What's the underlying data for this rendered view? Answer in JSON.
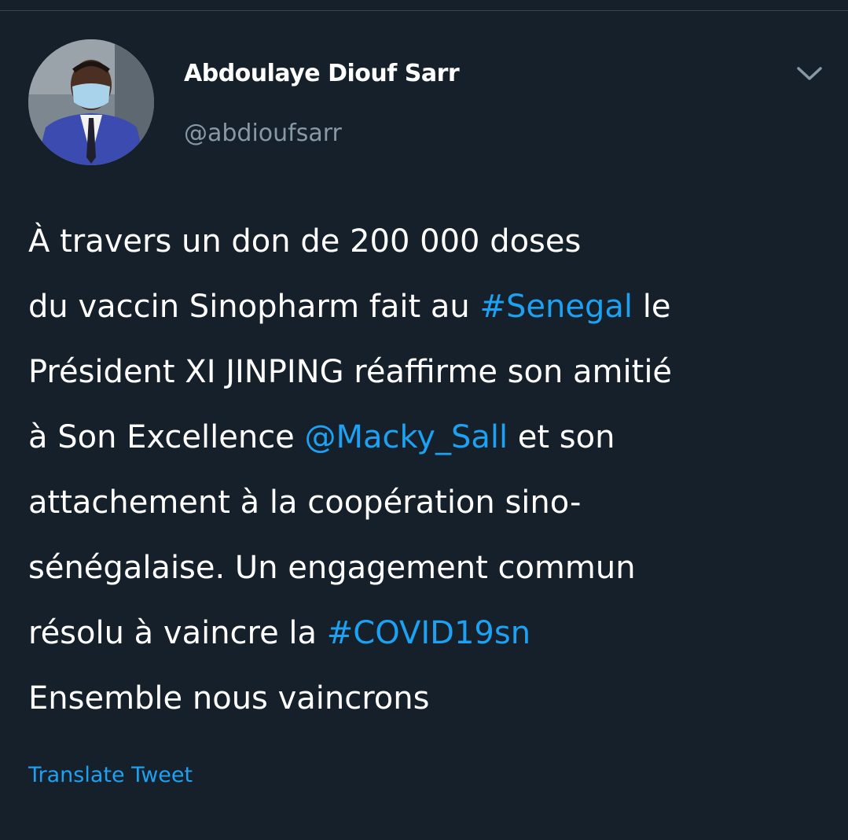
{
  "tweet": {
    "author": {
      "name": "Abdoulaye Diouf Sarr",
      "handle": "@abdioufsarr"
    },
    "body_lines": [
      [
        {
          "text": "À travers un don de 200 000 doses"
        }
      ],
      [
        {
          "text": "du vaccin Sinopharm fait au "
        },
        {
          "text": "#Senegal",
          "link": true
        },
        {
          "text": " le"
        }
      ],
      [
        {
          "text": "Président XI JINPING réaffirme son amitié"
        }
      ],
      [
        {
          "text": "à Son Excellence "
        },
        {
          "text": "@Macky_Sall",
          "link": true
        },
        {
          "text": " et son"
        }
      ],
      [
        {
          "text": "attachement à la coopération sino-"
        }
      ],
      [
        {
          "text": "sénégalaise. Un engagement commun"
        }
      ],
      [
        {
          "text": "résolu à vaincre la "
        },
        {
          "text": "#COVID19sn",
          "link": true
        }
      ],
      [
        {
          "text": "Ensemble nous vaincrons"
        }
      ]
    ],
    "translate_label": "Translate Tweet"
  },
  "icons": {
    "menu": "chevron-down-icon",
    "avatar": "profile-photo"
  },
  "colors": {
    "background": "#15202b",
    "text": "#ffffff",
    "secondary_text": "#8899a6",
    "link": "#1da1f2",
    "divider": "#38444d"
  }
}
